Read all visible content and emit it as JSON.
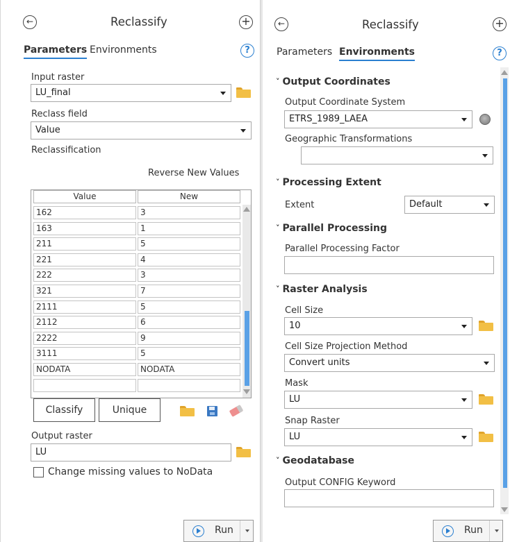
{
  "left": {
    "title": "Reclassify",
    "tabs": [
      "Parameters",
      "Environments"
    ],
    "active_tab": "Parameters",
    "input_raster_label": "Input raster",
    "input_raster_value": "LU_final",
    "reclass_field_label": "Reclass field",
    "reclass_field_value": "Value",
    "reclassification_label": "Reclassification",
    "reverse_label": "Reverse New Values",
    "table": {
      "columns": [
        "Value",
        "New"
      ],
      "rows": [
        [
          "162",
          "3"
        ],
        [
          "163",
          "1"
        ],
        [
          "211",
          "5"
        ],
        [
          "221",
          "4"
        ],
        [
          "222",
          "3"
        ],
        [
          "321",
          "7"
        ],
        [
          "2111",
          "5"
        ],
        [
          "2112",
          "6"
        ],
        [
          "2222",
          "9"
        ],
        [
          "3111",
          "5"
        ],
        [
          "NODATA",
          "NODATA"
        ],
        [
          "",
          ""
        ]
      ]
    },
    "classify_label": "Classify",
    "unique_label": "Unique",
    "output_raster_label": "Output raster",
    "output_raster_value": "LU",
    "missing_nodata_label": "Change missing values to NoData",
    "run_label": "Run"
  },
  "right": {
    "title": "Reclassify",
    "tabs": [
      "Parameters",
      "Environments"
    ],
    "active_tab": "Environments",
    "sections": {
      "output_coordinates": "Output Coordinates",
      "processing_extent": "Processing Extent",
      "parallel_processing": "Parallel Processing",
      "raster_analysis": "Raster Analysis",
      "geodatabase": "Geodatabase"
    },
    "output_cs_label": "Output Coordinate System",
    "output_cs_value": "ETRS_1989_LAEA",
    "geo_transform_label": "Geographic Transformations",
    "geo_transform_value": "",
    "extent_label": "Extent",
    "extent_value": "Default",
    "parallel_factor_label": "Parallel Processing Factor",
    "parallel_factor_value": "",
    "cell_size_label": "Cell Size",
    "cell_size_value": "10",
    "cell_size_method_label": "Cell Size Projection Method",
    "cell_size_method_value": "Convert units",
    "mask_label": "Mask",
    "mask_value": "LU",
    "snap_raster_label": "Snap Raster",
    "snap_raster_value": "LU",
    "config_keyword_label": "Output CONFIG Keyword",
    "config_keyword_value": "",
    "run_label": "Run"
  },
  "icons": {
    "back": "back-arrow-icon",
    "add": "add-icon",
    "help": "help-icon",
    "folder": "folder-icon",
    "save": "save-icon",
    "eraser": "eraser-icon",
    "globe": "globe-icon",
    "play": "play-icon"
  },
  "colors": {
    "accent": "#2a7fd0",
    "scroll_thumb": "#5aa1e6",
    "folder": "#f2bf45"
  }
}
